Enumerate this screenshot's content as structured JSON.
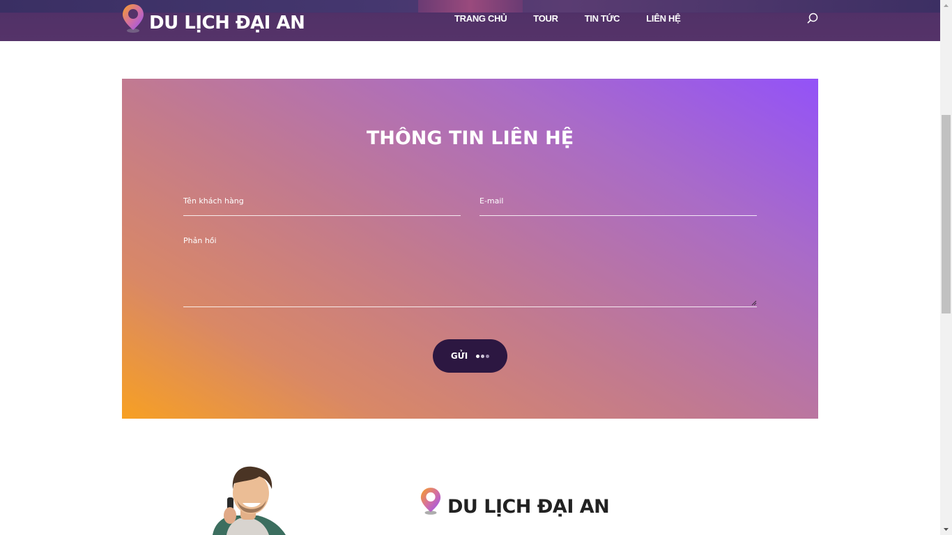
{
  "header": {
    "brand": "DU LỊCH ĐẠI AN",
    "nav": [
      "TRANG CHỦ",
      "TOUR",
      "TIN TỨC",
      "LIÊN HỆ"
    ],
    "search_icon": "search-icon"
  },
  "contact": {
    "title": "THÔNG TIN LIÊN HỆ",
    "name_placeholder": "Tên khách hàng",
    "email_placeholder": "E-mail",
    "message_placeholder": "Phản hồi",
    "submit_label": "GỬI"
  },
  "footer": {
    "brand": "DU LỊCH ĐẠI AN"
  },
  "colors": {
    "header_bg": "#553369",
    "gradient_start": "#9352f8",
    "gradient_end": "#f7a023",
    "button_bg": "#2c1741"
  }
}
